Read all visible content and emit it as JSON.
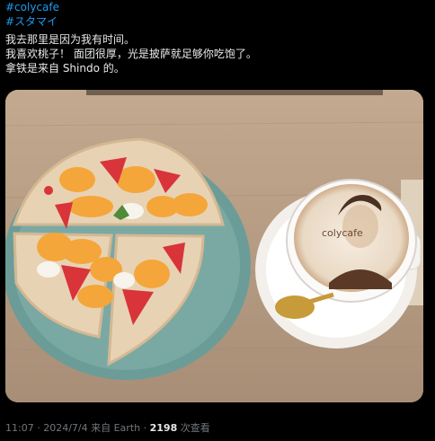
{
  "tweet": {
    "hashtags": [
      "#colycafe",
      "#スタマイ"
    ],
    "lines": [
      "我去那里是因为我有时间。",
      "我喜欢桃子！ 面团很厚，光是披萨就足够你吃饱了。",
      "拿铁是来自 Shindo 的。"
    ]
  },
  "media": {
    "latte_art_text": "colycafe"
  },
  "meta": {
    "time": "11:07",
    "sep1": "·",
    "date": "2024/7/4",
    "source": "来自 Earth",
    "sep2": "·",
    "views": "2198",
    "views_label": "次查看"
  }
}
